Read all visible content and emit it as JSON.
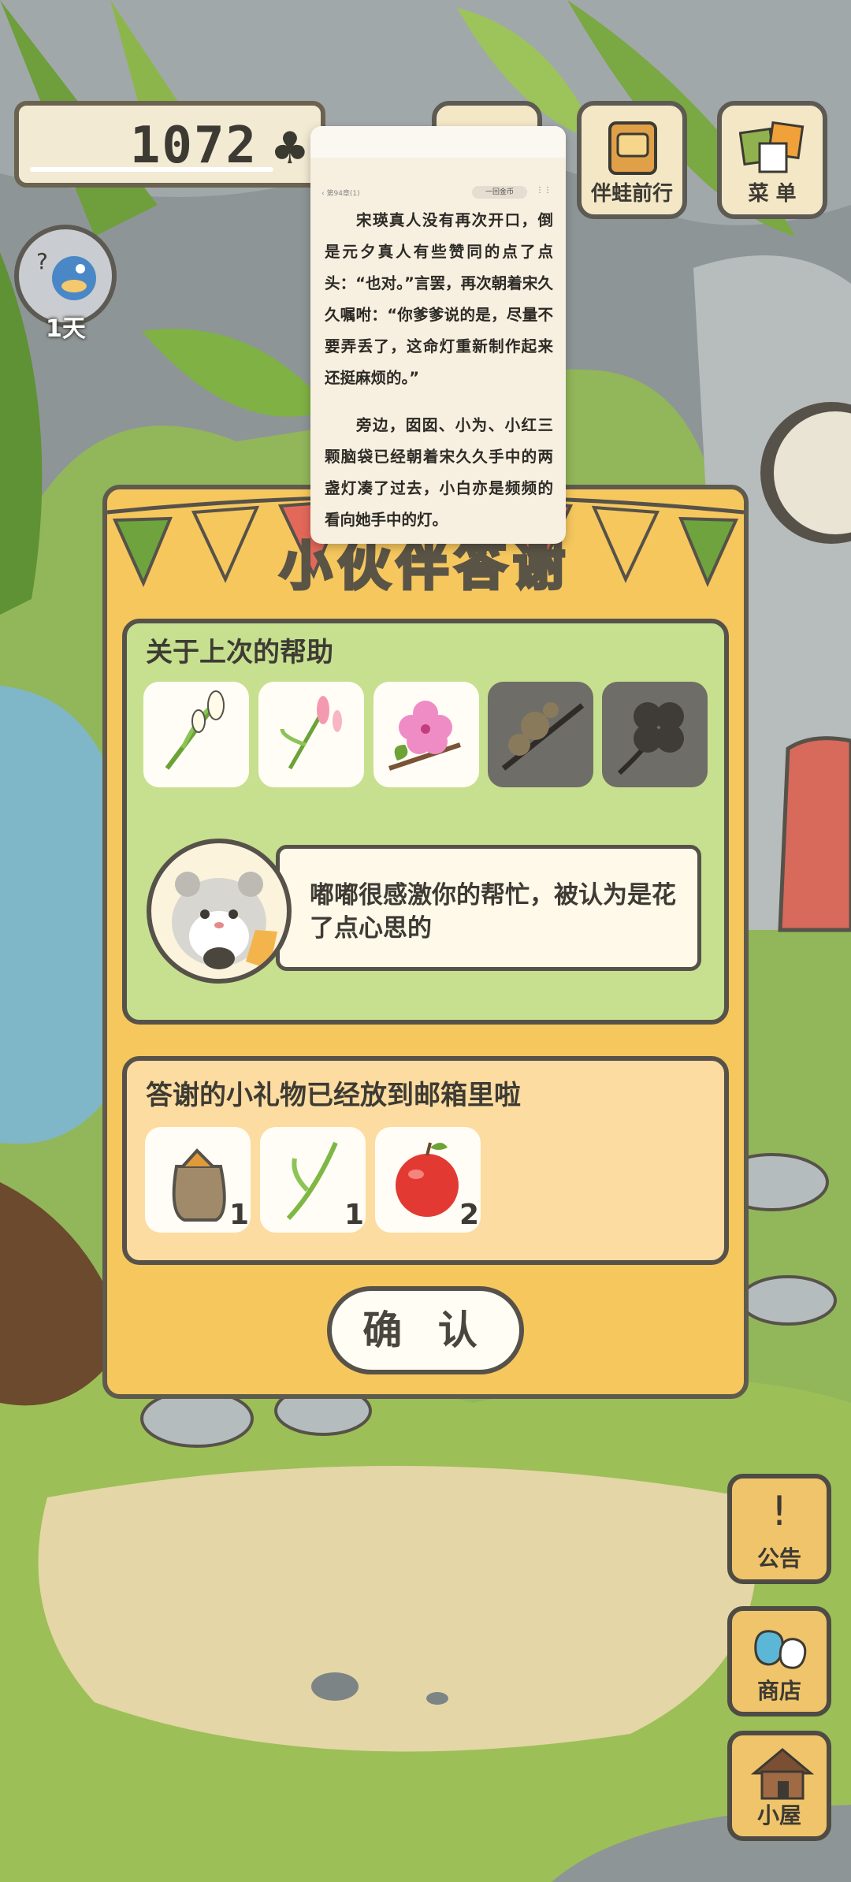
{
  "hud": {
    "clover_count": "1072",
    "clover_icon": "clover-icon",
    "day_label": "1天"
  },
  "top_buttons": [
    {
      "label": "伴蛙前行",
      "icon": "companion-icon"
    },
    {
      "label": "菜 单",
      "icon": "menu-cards-icon"
    }
  ],
  "side_buttons": [
    {
      "label": "公告",
      "icon": "exclamation-icon"
    },
    {
      "label": "商店",
      "icon": "shop-bags-icon"
    },
    {
      "label": "小屋",
      "icon": "house-icon"
    }
  ],
  "dialog": {
    "title": "小伙伴答谢",
    "help_section": {
      "heading": "关于上次的帮助",
      "items": [
        {
          "icon": "white-flower-sprig-icon",
          "owned": true
        },
        {
          "icon": "pink-flower-sprig-icon",
          "owned": true
        },
        {
          "icon": "hibiscus-flower-icon",
          "owned": true
        },
        {
          "icon": "plum-blossom-branch-icon",
          "owned": false
        },
        {
          "icon": "four-leaf-clover-icon",
          "owned": false
        }
      ],
      "speech": "嘟嘟很感激你的帮忙，被认为是花了点心思的"
    },
    "gift_section": {
      "heading": "答谢的小礼物已经放到邮箱里啦",
      "gifts": [
        {
          "icon": "seed-bag-icon",
          "count": "1"
        },
        {
          "icon": "grass-sprig-icon",
          "count": "1"
        },
        {
          "icon": "apple-icon",
          "count": "2"
        }
      ]
    },
    "confirm_label": "确 认"
  },
  "reader_overlay": {
    "chapter": "第94章(1)",
    "coin_chip": "一回金币",
    "paragraph1": "宋瑛真人没有再次开口，倒是元夕真人有些赞同的点了点头：“也对。”言罢，再次朝着宋久久嘱咐：“你爹爹说的是，尽量不要弄丢了，这命灯重新制作起来还挺麻烦的。”",
    "paragraph2": "旁边，囡囡、小为、小红三颗脑袋已经朝着宋久久手中的两盏灯凑了过去，小白亦是频频的看向她手中的灯。"
  }
}
